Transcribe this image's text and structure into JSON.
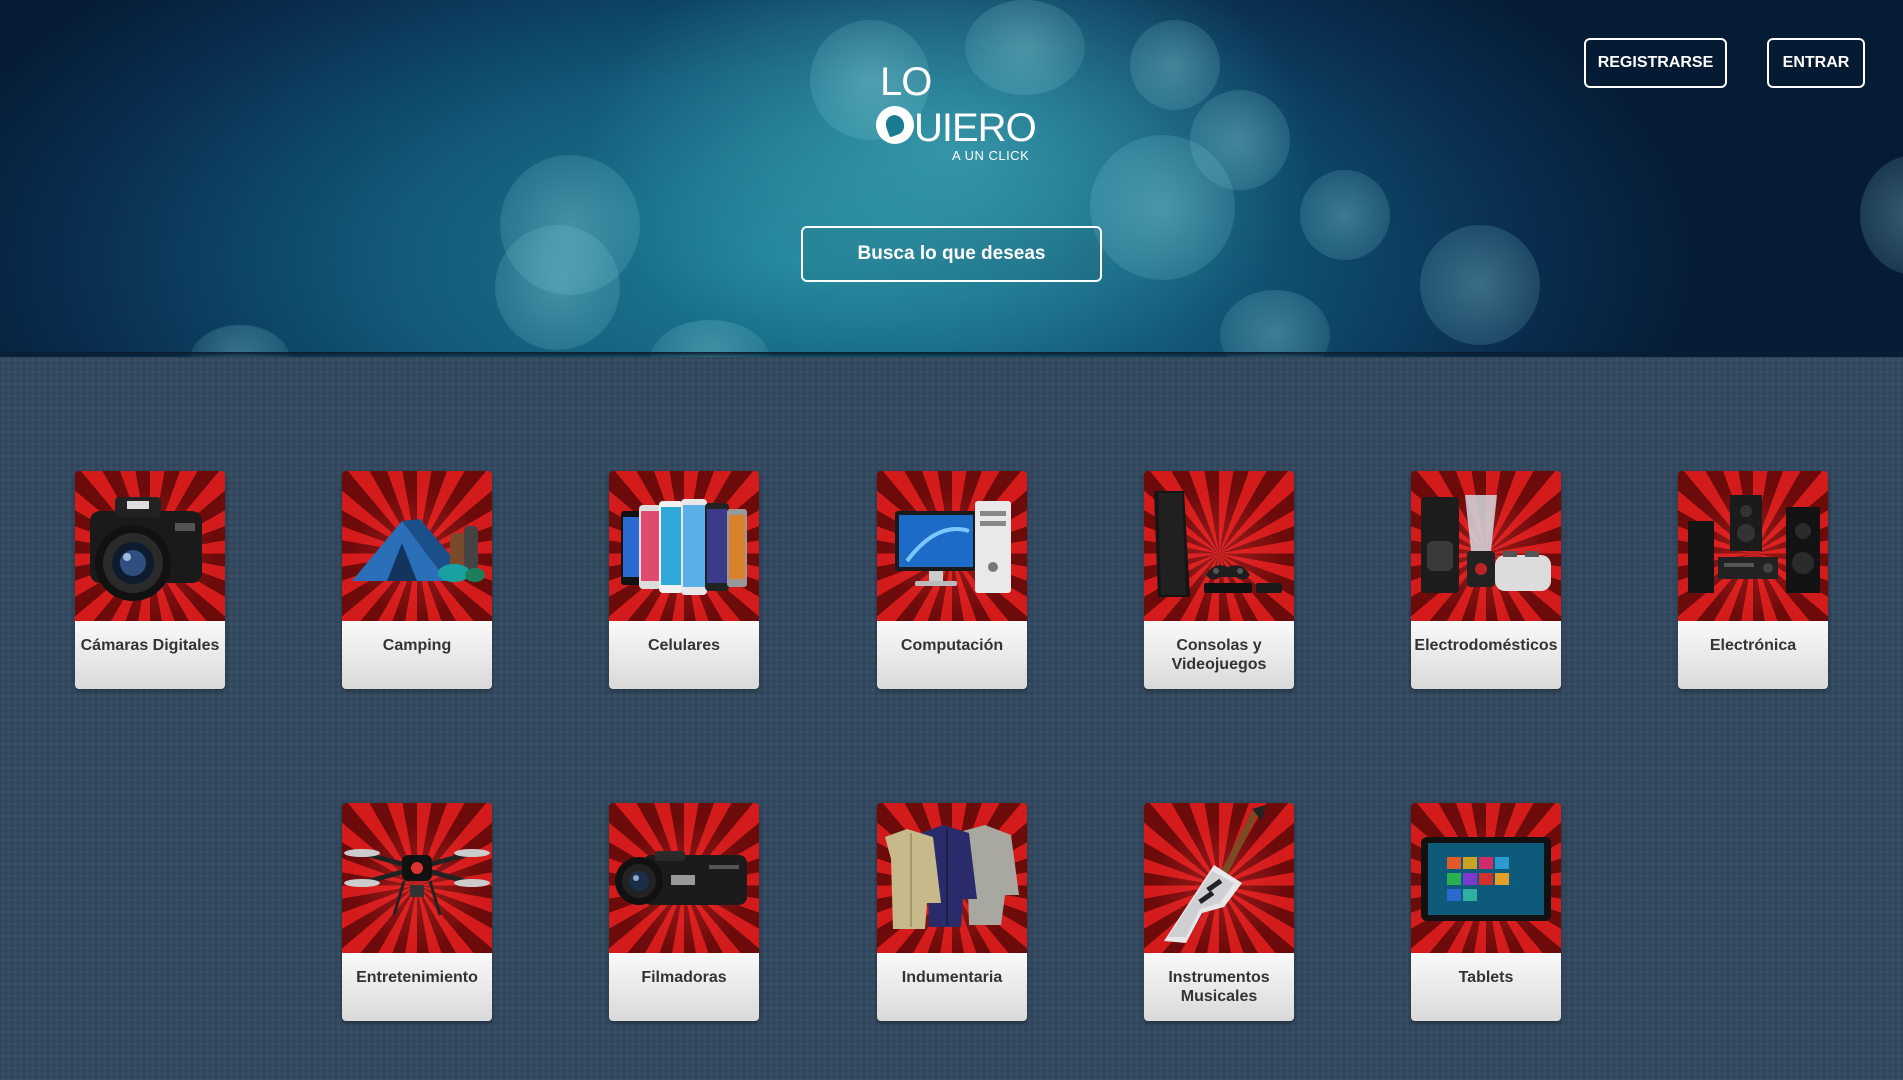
{
  "header": {
    "logo": {
      "line1": "LO",
      "line2_rest": "UIERO",
      "tagline": "A UN CLICK"
    },
    "register_label": "REGISTRARSE",
    "login_label": "ENTRAR",
    "search_label": "Busca lo que deseas"
  },
  "categories": [
    {
      "label": "Cámaras Digitales",
      "icon": "camera-icon"
    },
    {
      "label": "Camping",
      "icon": "tent-icon"
    },
    {
      "label": "Celulares",
      "icon": "smartphones-icon"
    },
    {
      "label": "Computación",
      "icon": "desktop-computer-icon"
    },
    {
      "label": "Consolas y Videojuegos",
      "icon": "game-console-icon"
    },
    {
      "label": "Electrodomésticos",
      "icon": "appliances-icon"
    },
    {
      "label": "Electrónica",
      "icon": "home-theater-icon"
    },
    {
      "label": "Entretenimiento",
      "icon": "drone-icon"
    },
    {
      "label": "Filmadoras",
      "icon": "camcorder-icon"
    },
    {
      "label": "Indumentaria",
      "icon": "shirts-icon"
    },
    {
      "label": "Instrumentos Musicales",
      "icon": "electric-guitar-icon"
    },
    {
      "label": "Tablets",
      "icon": "tablet-icon"
    }
  ],
  "colors": {
    "card_burst_red": "#d31b1b",
    "card_burst_dark": "#6d0a0a",
    "page_background": "#33495f"
  }
}
